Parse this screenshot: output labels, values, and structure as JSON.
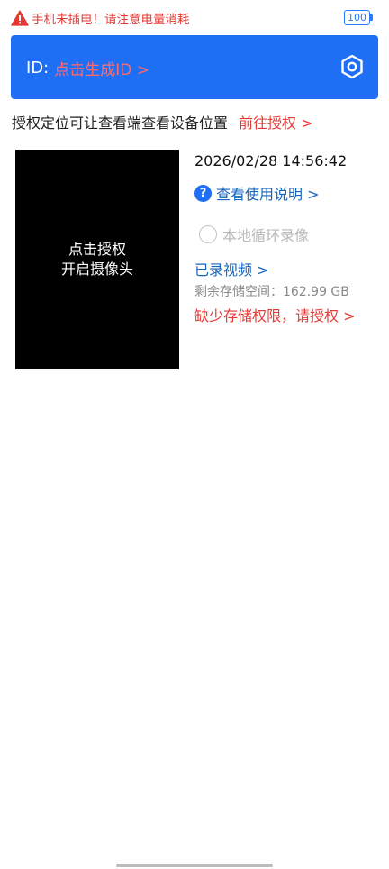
{
  "warning": {
    "icon": "warning-triangle-icon",
    "text": "手机未插电！请注意电量消耗"
  },
  "battery": {
    "level": "100"
  },
  "id_card": {
    "label": "ID:",
    "link": "点击生成ID >",
    "settings_icon": "settings-hexagon-icon"
  },
  "location": {
    "text": "授权定位可让查看端查看设备位置",
    "link": "前往授权 >"
  },
  "camera": {
    "line1": "点击授权",
    "line2": "开启摄像头"
  },
  "info": {
    "datetime": "2026/02/28 14:56:42",
    "help_icon": "?",
    "help_link": "查看使用说明 >",
    "loop_record": "本地循环录像",
    "videos_link": "已录视频 >",
    "storage_remaining": "剩余存储空间：162.99 GB",
    "storage_permission": "缺少存储权限，请授权 >"
  },
  "colors": {
    "accent": "#1f6ff5",
    "warning": "#e53935",
    "link": "#1565c0"
  }
}
